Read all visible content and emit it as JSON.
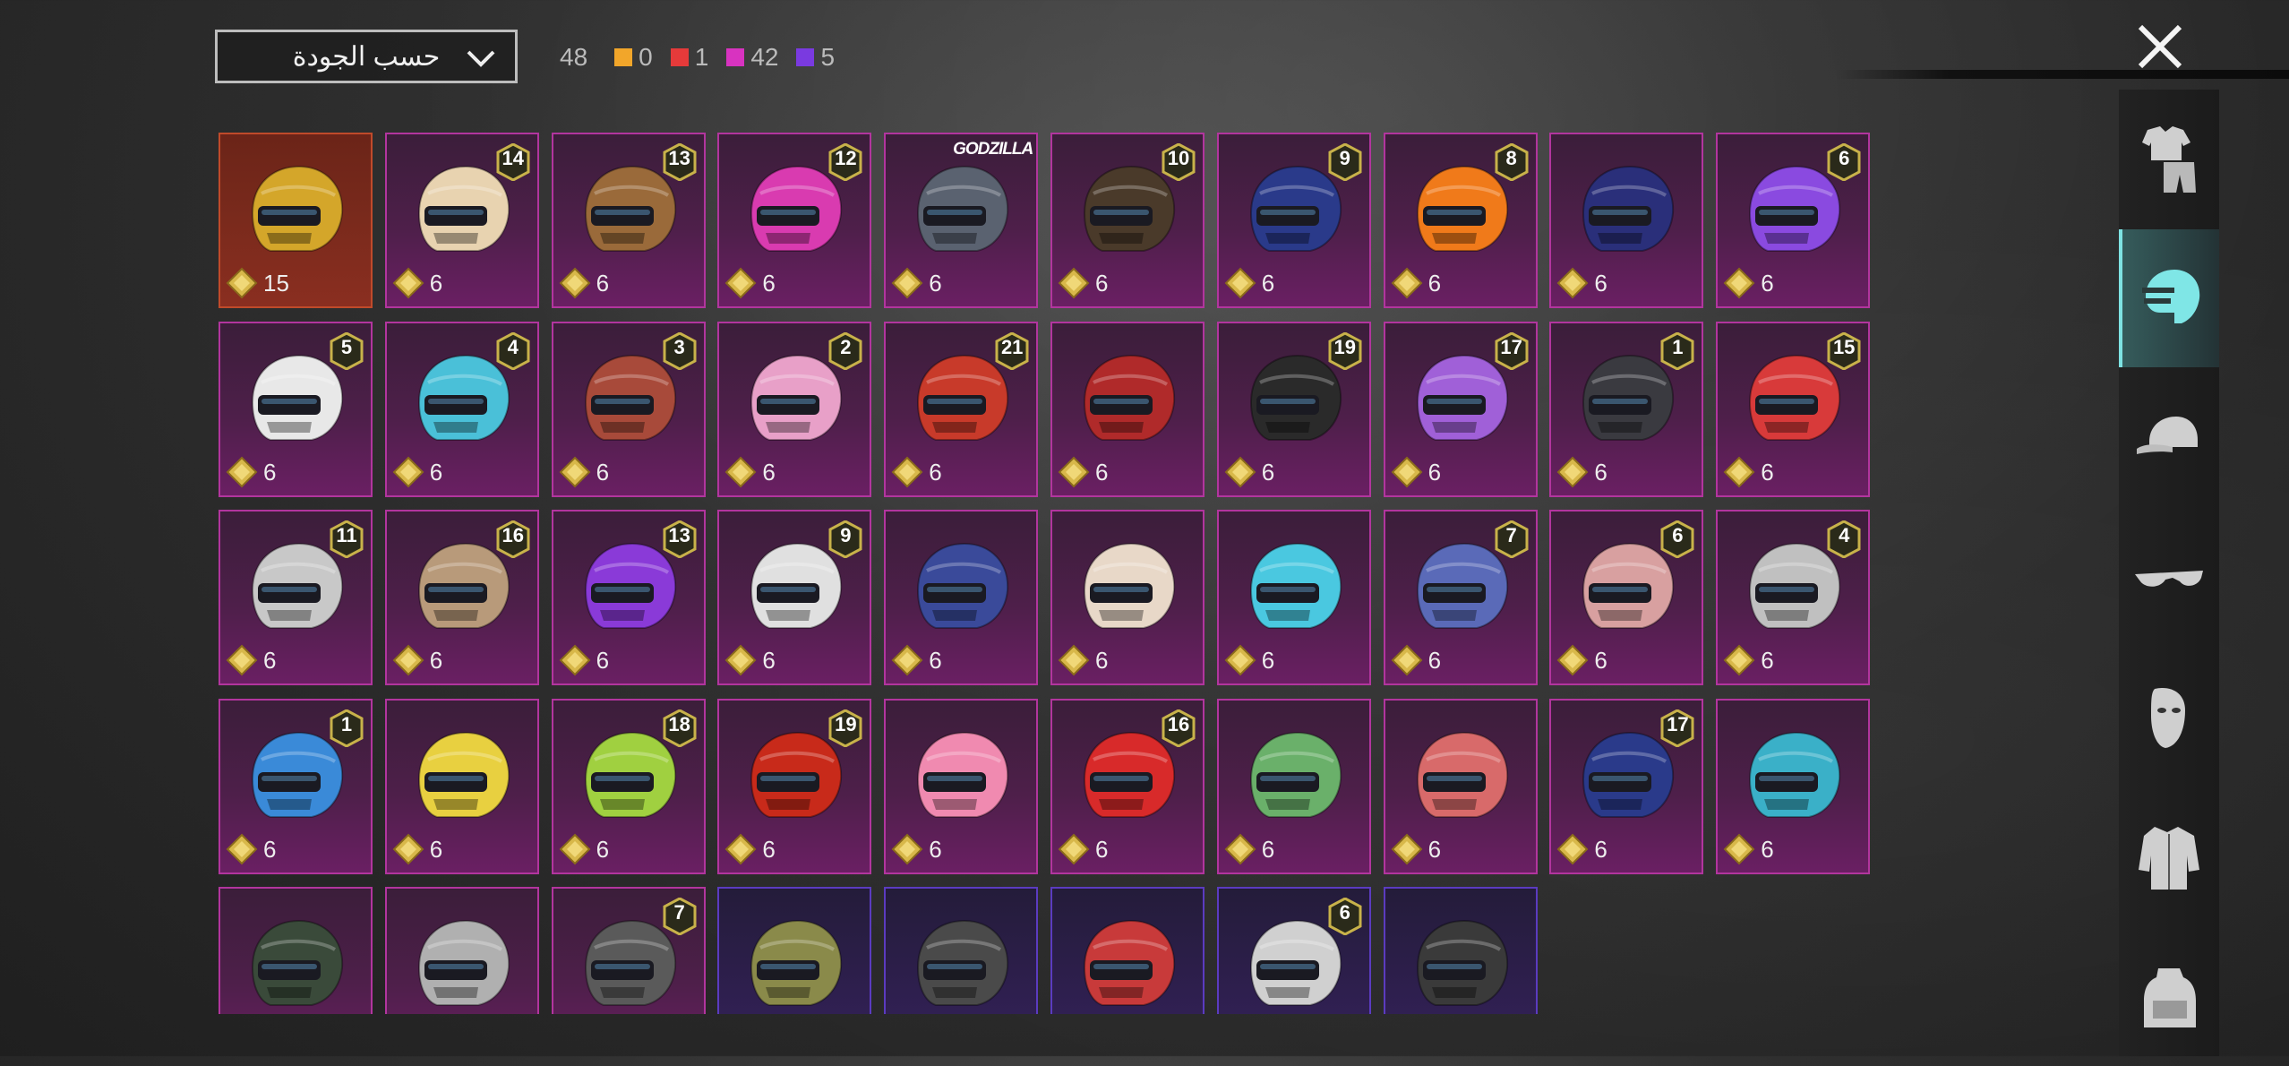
{
  "sort": {
    "label": "حسب الجودة",
    "icon": "chevron-down-icon"
  },
  "counts": {
    "total": "48",
    "items": [
      {
        "color": "#f2a62a",
        "value": "0"
      },
      {
        "color": "#e53a3a",
        "value": "1"
      },
      {
        "color": "#d833c0",
        "value": "42"
      },
      {
        "color": "#7a3ae0",
        "value": "5"
      }
    ]
  },
  "close": {
    "icon": "close-icon"
  },
  "sidebar": [
    {
      "icon": "outfit-icon",
      "active": false
    },
    {
      "icon": "helmet-icon",
      "active": true
    },
    {
      "icon": "cap-icon",
      "active": false
    },
    {
      "icon": "glasses-icon",
      "active": false
    },
    {
      "icon": "mask-icon",
      "active": false
    },
    {
      "icon": "jacket-icon",
      "active": false
    },
    {
      "icon": "backpack-icon",
      "active": false
    }
  ],
  "cards": [
    {
      "badge": "",
      "cost": "15",
      "rarity": "gold",
      "color": "#d4a62a"
    },
    {
      "badge": "14",
      "cost": "6",
      "rarity": "pink",
      "color": "#e8d3b0"
    },
    {
      "badge": "13",
      "cost": "6",
      "rarity": "pink",
      "color": "#9a6a3a"
    },
    {
      "badge": "12",
      "cost": "6",
      "rarity": "pink",
      "color": "#d93bb0"
    },
    {
      "badge": "",
      "brand": "GODZILLA",
      "cost": "6",
      "rarity": "pink",
      "color": "#5a6270"
    },
    {
      "badge": "10",
      "cost": "6",
      "rarity": "pink",
      "color": "#4a3a2a"
    },
    {
      "badge": "9",
      "cost": "6",
      "rarity": "pink",
      "color": "#2a3a8a"
    },
    {
      "badge": "8",
      "cost": "6",
      "rarity": "pink",
      "color": "#f07a1a"
    },
    {
      "badge": "",
      "cost": "6",
      "rarity": "pink",
      "color": "#2a2f7a"
    },
    {
      "badge": "6",
      "cost": "6",
      "rarity": "pink",
      "color": "#8a4ae0"
    },
    {
      "badge": "5",
      "cost": "6",
      "rarity": "pink",
      "color": "#e8e8e8"
    },
    {
      "badge": "4",
      "cost": "6",
      "rarity": "pink",
      "color": "#4ac0d8"
    },
    {
      "badge": "3",
      "cost": "6",
      "rarity": "pink",
      "color": "#a84a3a"
    },
    {
      "badge": "2",
      "cost": "6",
      "rarity": "pink",
      "color": "#e8a0c8"
    },
    {
      "badge": "21",
      "cost": "6",
      "rarity": "pink",
      "color": "#c83a2a"
    },
    {
      "badge": "",
      "cost": "6",
      "rarity": "pink",
      "color": "#b02a2a"
    },
    {
      "badge": "19",
      "cost": "6",
      "rarity": "pink",
      "color": "#2a2a2a"
    },
    {
      "badge": "17",
      "cost": "6",
      "rarity": "pink",
      "color": "#a060d8"
    },
    {
      "badge": "1",
      "cost": "6",
      "rarity": "pink",
      "color": "#3a3a40"
    },
    {
      "badge": "15",
      "cost": "6",
      "rarity": "pink",
      "color": "#d83a3a"
    },
    {
      "badge": "11",
      "cost": "6",
      "rarity": "pink",
      "color": "#c8c8c8"
    },
    {
      "badge": "16",
      "cost": "6",
      "rarity": "pink",
      "color": "#b89a7a"
    },
    {
      "badge": "13",
      "cost": "6",
      "rarity": "pink",
      "color": "#8a3ad8"
    },
    {
      "badge": "9",
      "cost": "6",
      "rarity": "pink",
      "color": "#e0e0e0"
    },
    {
      "badge": "",
      "cost": "6",
      "rarity": "pink",
      "color": "#3a4a9a"
    },
    {
      "badge": "",
      "cost": "6",
      "rarity": "pink",
      "color": "#e8d8c8"
    },
    {
      "badge": "",
      "cost": "6",
      "rarity": "pink",
      "color": "#4ac8e0"
    },
    {
      "badge": "7",
      "cost": "6",
      "rarity": "pink",
      "color": "#5a6ab8"
    },
    {
      "badge": "6",
      "cost": "6",
      "rarity": "pink",
      "color": "#d8a0a0"
    },
    {
      "badge": "4",
      "cost": "6",
      "rarity": "pink",
      "color": "#c0c0c0"
    },
    {
      "badge": "1",
      "cost": "6",
      "rarity": "pink",
      "color": "#3a8ad8"
    },
    {
      "badge": "",
      "cost": "6",
      "rarity": "pink",
      "color": "#e8d040"
    },
    {
      "badge": "18",
      "cost": "6",
      "rarity": "pink",
      "color": "#a0d040"
    },
    {
      "badge": "19",
      "cost": "6",
      "rarity": "pink",
      "color": "#c82a1a"
    },
    {
      "badge": "",
      "cost": "6",
      "rarity": "pink",
      "color": "#f08ab0"
    },
    {
      "badge": "16",
      "cost": "6",
      "rarity": "pink",
      "color": "#d82a2a"
    },
    {
      "badge": "",
      "cost": "6",
      "rarity": "pink",
      "color": "#6ab06a"
    },
    {
      "badge": "",
      "cost": "6",
      "rarity": "pink",
      "color": "#d86a6a"
    },
    {
      "badge": "17",
      "cost": "6",
      "rarity": "pink",
      "color": "#2a3a8a"
    },
    {
      "badge": "",
      "cost": "6",
      "rarity": "pink",
      "color": "#3ab0c8"
    },
    {
      "badge": "",
      "cost": "",
      "rarity": "pink",
      "color": "#3a4a3a"
    },
    {
      "badge": "",
      "cost": "",
      "rarity": "pink",
      "color": "#b0b0b0"
    },
    {
      "badge": "7",
      "cost": "",
      "rarity": "pink",
      "color": "#5a5a5a"
    },
    {
      "badge": "",
      "cost": "",
      "rarity": "purple",
      "color": "#8a8a4a"
    },
    {
      "badge": "",
      "cost": "",
      "rarity": "purple",
      "color": "#4a4a4a"
    },
    {
      "badge": "",
      "cost": "",
      "rarity": "purple",
      "color": "#c83a3a"
    },
    {
      "badge": "6",
      "cost": "",
      "rarity": "purple",
      "color": "#d0d0d0"
    },
    {
      "badge": "",
      "cost": "",
      "rarity": "purple",
      "color": "#3a3a3a"
    }
  ]
}
